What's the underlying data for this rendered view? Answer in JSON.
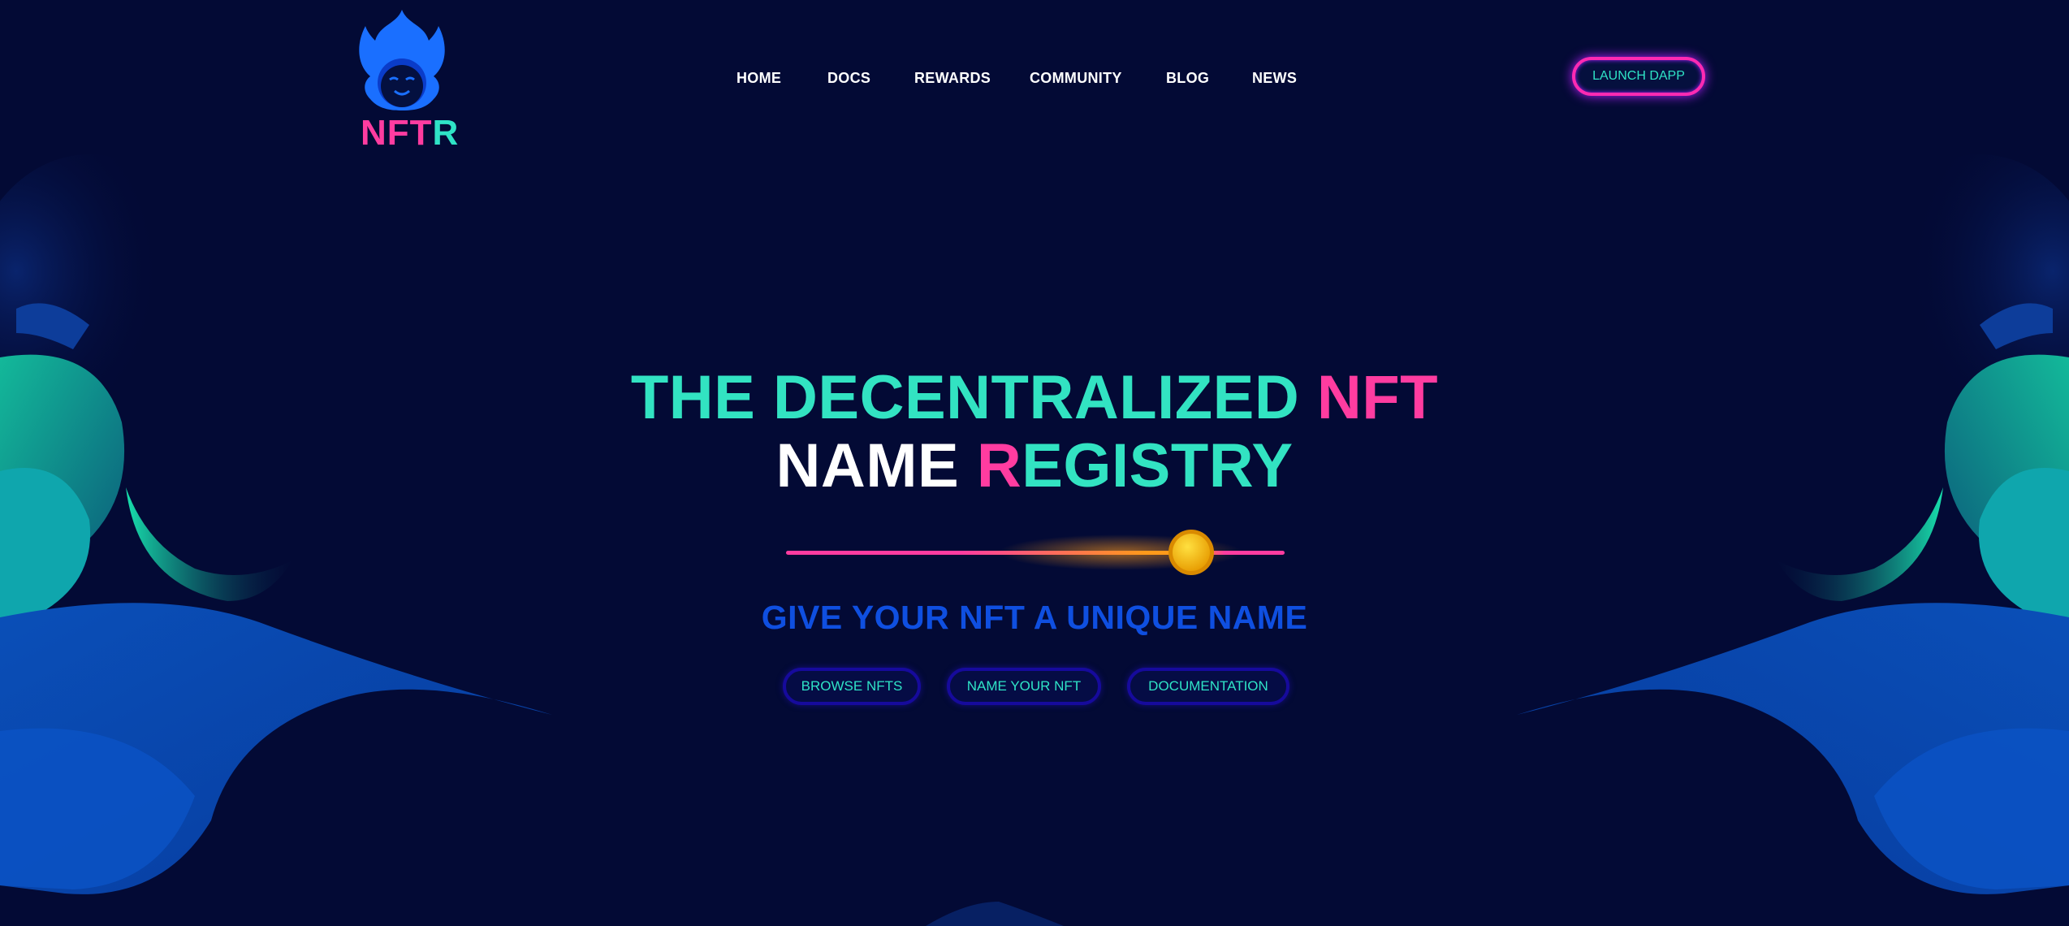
{
  "brand": {
    "logo_first": "NFT",
    "logo_last": "R"
  },
  "nav": [
    {
      "label": "HOME"
    },
    {
      "label": "DOCS"
    },
    {
      "label": "REWARDS"
    },
    {
      "label": "COMMUNITY"
    },
    {
      "label": "BLOG"
    },
    {
      "label": "NEWS"
    }
  ],
  "launch_button": "LAUNCH DAPP",
  "hero": {
    "line1_a": "THE DECENTRALIZED ",
    "line1_b": "NFT",
    "line2_a": "NAME ",
    "line2_b": "R",
    "line2_c": "EGISTRY",
    "subtitle": "GIVE YOUR NFT A UNIQUE NAME"
  },
  "actions": [
    {
      "label": "BROWSE NFTS"
    },
    {
      "label": "NAME YOUR NFT"
    },
    {
      "label": "DOCUMENTATION"
    }
  ],
  "colors": {
    "background": "#030a35",
    "teal": "#32e3c2",
    "pink": "#ff3ca0",
    "blue": "#0f4fe0",
    "coin": "#ffc400"
  }
}
